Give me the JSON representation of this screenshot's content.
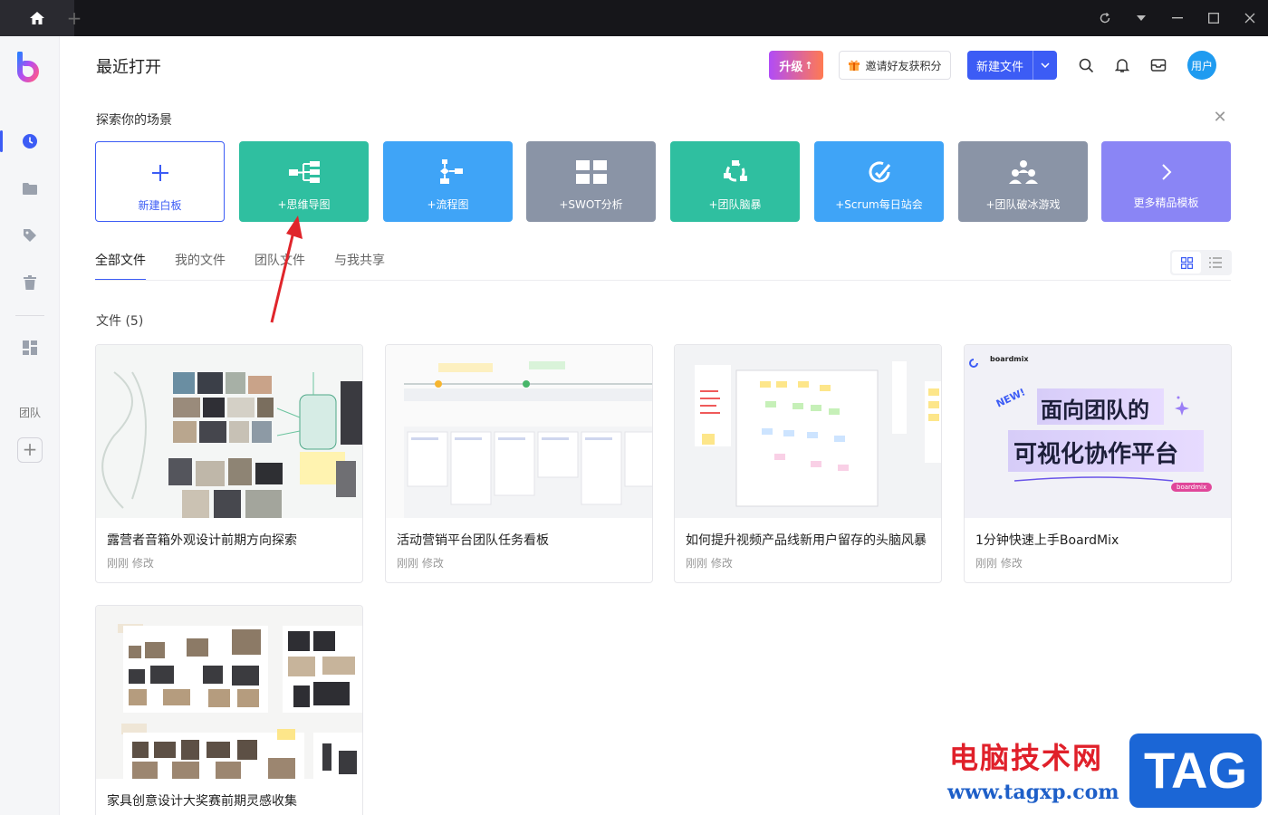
{
  "header": {
    "title": "最近打开",
    "upgrade_label": "升级",
    "invite_label": "邀请好友获积分",
    "new_file_label": "新建文件",
    "avatar_label": "用户"
  },
  "sidebar": {
    "team_label": "团队"
  },
  "scenes": {
    "label": "探索你的场景",
    "items": [
      {
        "label": "新建白板"
      },
      {
        "label": "+思维导图"
      },
      {
        "label": "+流程图"
      },
      {
        "label": "+SWOT分析"
      },
      {
        "label": "+团队脑暴"
      },
      {
        "label": "+Scrum每日站会"
      },
      {
        "label": "+团队破冰游戏"
      },
      {
        "label": "更多精品模板"
      }
    ]
  },
  "tabs": [
    {
      "label": "全部文件",
      "active": true
    },
    {
      "label": "我的文件"
    },
    {
      "label": "团队文件"
    },
    {
      "label": "与我共享"
    }
  ],
  "files": {
    "count_label": "文件 (5)",
    "items": [
      {
        "name": "露营者音箱外观设计前期方向探索",
        "meta": "刚刚 修改"
      },
      {
        "name": "活动营销平台团队任务看板",
        "meta": "刚刚 修改"
      },
      {
        "name": "如何提升视频产品线新用户留存的头脑风暴",
        "meta": "刚刚 修改"
      },
      {
        "name": "1分钟快速上手BoardMix",
        "meta": "刚刚 修改"
      },
      {
        "name": "家具创意设计大奖赛前期灵感收集",
        "meta": ""
      }
    ],
    "boardmix_thumb": {
      "brand": "boardmix",
      "badge": "NEW!",
      "line1": "面向团队的",
      "line2": "可视化协作平台",
      "tag": "boardmix"
    }
  },
  "watermark": {
    "cn": "电脑技术网",
    "url": "www.tagxp.com",
    "tag": "TAG"
  },
  "colors": {
    "accent": "#3c5cf5",
    "teal": "#2fbfa0",
    "blue": "#3fa4f7",
    "gray": "#8a94a6",
    "purple": "#8a85f5"
  }
}
